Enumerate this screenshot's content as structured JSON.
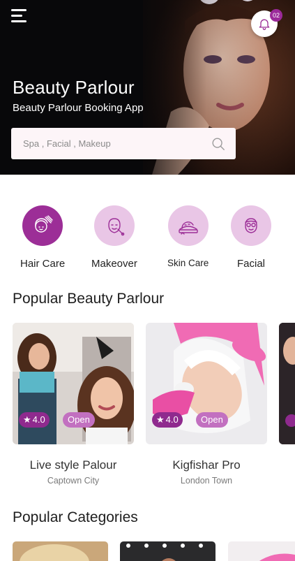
{
  "header": {
    "title": "Beauty Parlour",
    "subtitle": "Beauty Parlour Booking App",
    "notification_count": "02"
  },
  "search": {
    "placeholder": "Spa , Facial , Makeup"
  },
  "services": [
    {
      "label": "Hair Care",
      "icon": "hair-care-icon",
      "active": true
    },
    {
      "label": "Makeover",
      "icon": "makeover-icon",
      "active": false
    },
    {
      "label": "Skin Care",
      "icon": "skin-care-icon",
      "active": false
    },
    {
      "label": "Facial",
      "icon": "facial-icon",
      "active": false
    }
  ],
  "popular_parlours": {
    "title": "Popular Beauty Parlour",
    "items": [
      {
        "name": "Live style Palour",
        "location": "Captown City",
        "rating": "4.0",
        "status": "Open"
      },
      {
        "name": "Kigfishar Pro",
        "location": "London Town",
        "rating": "4.0",
        "status": "Open"
      }
    ]
  },
  "popular_categories": {
    "title": "Popular Categories"
  },
  "colors": {
    "accent": "#9c2e97",
    "accent_light": "#e9c6e6",
    "badge_status": "#c270c0"
  }
}
